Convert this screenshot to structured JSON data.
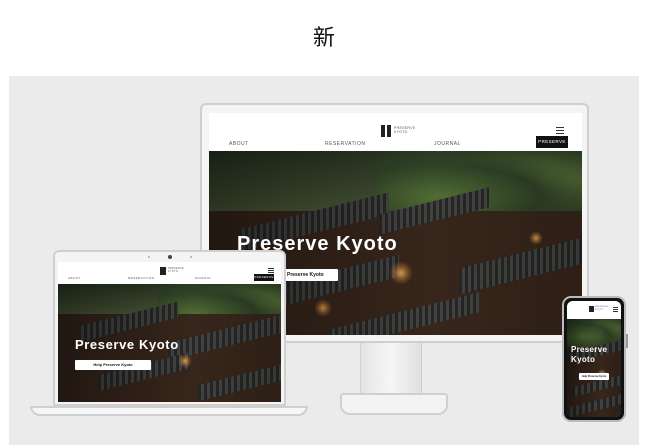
{
  "header_char": "新",
  "site": {
    "logo_letter": "K",
    "logo_text_line1": "PRESERVE",
    "logo_text_line2": "KYOTO",
    "nav": [
      "ABOUT",
      "RESERVATION",
      "JOURNAL"
    ],
    "cta_label": "PRESERVE",
    "hero_title": "Preserve Kyoto",
    "hero_button": "Preserve Kyoto",
    "hero_button_laptop": "Help Preserve Kyoto",
    "hero_button_phone": "Help Preserve Kyoto"
  },
  "devices": [
    "desktop",
    "laptop",
    "phone"
  ],
  "colors": {
    "stage_bg": "#ebebeb",
    "cta_bg": "#111111",
    "accent_text": "#ffffff"
  }
}
